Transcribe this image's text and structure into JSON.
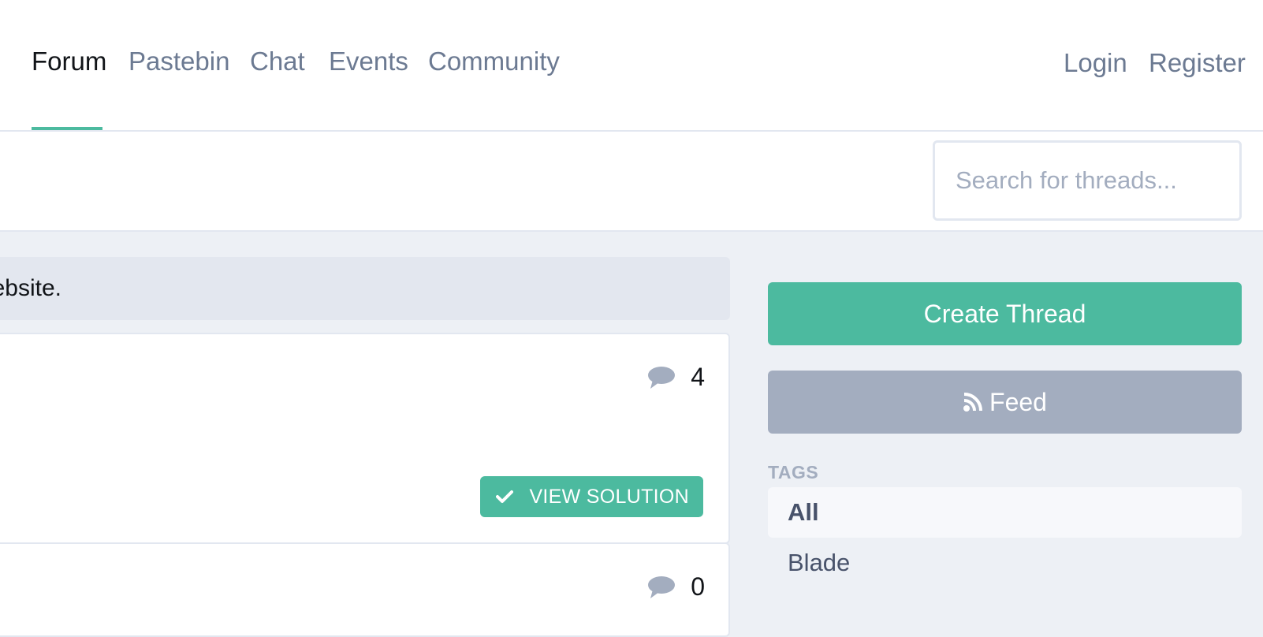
{
  "nav": {
    "links": [
      {
        "label": "Forum",
        "active": true
      },
      {
        "label": "Pastebin",
        "active": false
      },
      {
        "label": "Chat",
        "active": false
      },
      {
        "label": "Events",
        "active": false
      },
      {
        "label": "Community",
        "active": false
      }
    ],
    "login": "Login",
    "register": "Register"
  },
  "search": {
    "placeholder": "Search for threads..."
  },
  "notice": {
    "text": "ebsite."
  },
  "threads": [
    {
      "reply_count": "4",
      "solution_label": "VIEW SOLUTION"
    },
    {
      "reply_count": "0"
    }
  ],
  "sidebar": {
    "create_thread": "Create Thread",
    "feed": "Feed",
    "tags_heading": "TAGS",
    "tags": [
      "All",
      "Blade"
    ]
  },
  "colors": {
    "accent": "#4cba9f",
    "muted": "#a3adbf",
    "nav_text": "#6c7a92",
    "background": "#edf0f5"
  }
}
